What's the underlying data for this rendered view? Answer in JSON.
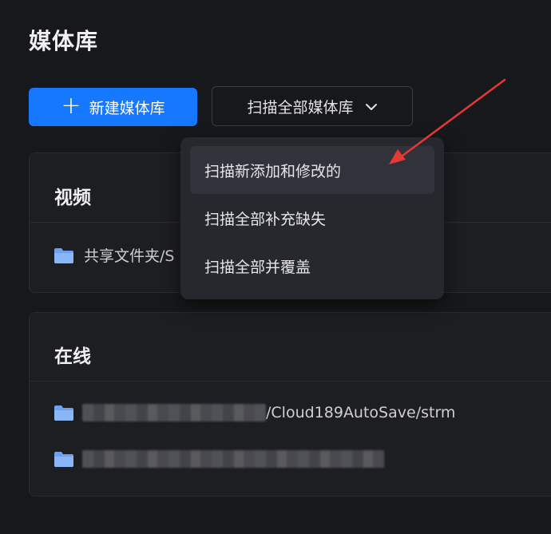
{
  "page": {
    "title": "媒体库"
  },
  "toolbar": {
    "new_label": "新建媒体库",
    "scan_label": "扫描全部媒体库",
    "accent": "#1677ff"
  },
  "dropdown": {
    "items": [
      {
        "label": "扫描新添加和修改的",
        "hovered": true
      },
      {
        "label": "扫描全部补充缺失"
      },
      {
        "label": "扫描全部并覆盖"
      }
    ]
  },
  "libraries": [
    {
      "name": "视频",
      "paths": [
        {
          "visible_text": "共享文件夹/S",
          "icon": "folder-icon"
        }
      ]
    },
    {
      "name": "在线",
      "paths": [
        {
          "visible_text": "/Cloud189AutoSave/strm",
          "redacted_prefix": true,
          "icon": "folder-icon"
        },
        {
          "visible_text": "",
          "redacted_prefix": true,
          "icon": "folder-icon"
        }
      ]
    }
  ],
  "annotation": {
    "type": "arrow",
    "color": "#e53935"
  }
}
